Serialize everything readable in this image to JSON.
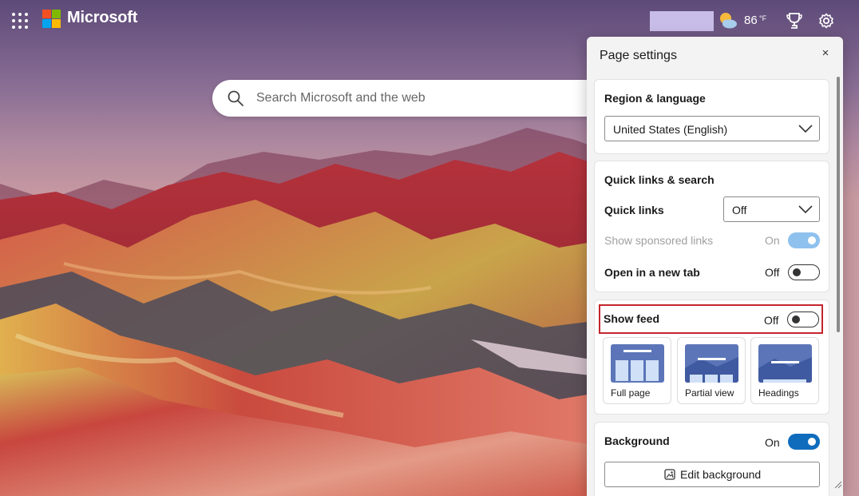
{
  "header": {
    "brand": "Microsoft",
    "weather_temp": "86",
    "weather_unit": "°F",
    "icons": [
      "app-launcher-icon",
      "microsoft-logo",
      "weather-icon",
      "rewards-trophy-icon",
      "settings-gear-icon"
    ]
  },
  "search": {
    "placeholder": "Search Microsoft and the web"
  },
  "panel": {
    "title": "Page settings",
    "close_glyph": "×",
    "region": {
      "title": "Region & language",
      "selected": "United States (English)"
    },
    "quick": {
      "title": "Quick links & search",
      "quick_links_label": "Quick links",
      "quick_links_value": "Off",
      "sponsored_label": "Show sponsored links",
      "sponsored_state": "On",
      "newtab_label": "Open in a new tab",
      "newtab_state": "Off"
    },
    "feed": {
      "label": "Show feed",
      "state": "Off",
      "layouts": [
        {
          "label": "Full page"
        },
        {
          "label": "Partial view"
        },
        {
          "label": "Headings"
        }
      ]
    },
    "background": {
      "label": "Background",
      "state": "On",
      "edit_label": "Edit background"
    }
  },
  "colors": {
    "accent": "#0f6cbd",
    "highlight": "#c4262e",
    "user_box": "#c7bde8"
  }
}
